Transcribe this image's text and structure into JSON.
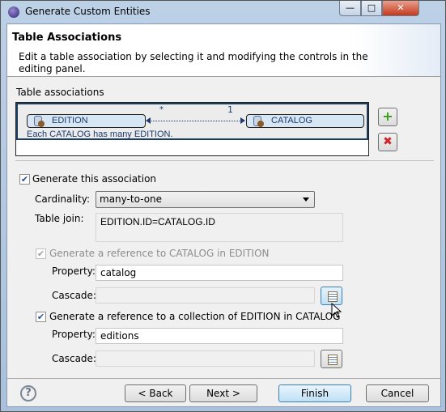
{
  "window": {
    "title": "Generate Custom Entities",
    "minimize": "—",
    "maximize": "□",
    "close": "✕"
  },
  "header": {
    "title": "Table Associations",
    "description": "Edit a table association by selecting it and modifying the controls in the editing panel."
  },
  "associations": {
    "label": "Table associations",
    "source": "EDITION",
    "target": "CATALOG",
    "source_mult": "*",
    "target_mult": "1",
    "summary": "Each CATALOG has many EDITION.",
    "add": "+",
    "remove": "✖"
  },
  "form": {
    "generate_label": "Generate this association",
    "generate_checked": true,
    "cardinality_label": "Cardinality:",
    "cardinality_value": "many-to-one",
    "join_label": "Table join:",
    "join_value": "EDITION.ID=CATALOG.ID",
    "ref1_label": "Generate a reference to CATALOG in EDITION",
    "ref1_checked": true,
    "ref1_property_label": "Property:",
    "ref1_property": "catalog",
    "ref1_cascade_label": "Cascade:",
    "ref1_cascade": "",
    "ref2_label": "Generate a reference to a collection of EDITION in CATALOG",
    "ref2_checked": true,
    "ref2_property_label": "Property:",
    "ref2_property": "editions",
    "ref2_cascade_label": "Cascade:",
    "ref2_cascade": ""
  },
  "footer": {
    "help": "?",
    "back": "< Back",
    "next": "Next >",
    "finish": "Finish",
    "cancel": "Cancel"
  }
}
